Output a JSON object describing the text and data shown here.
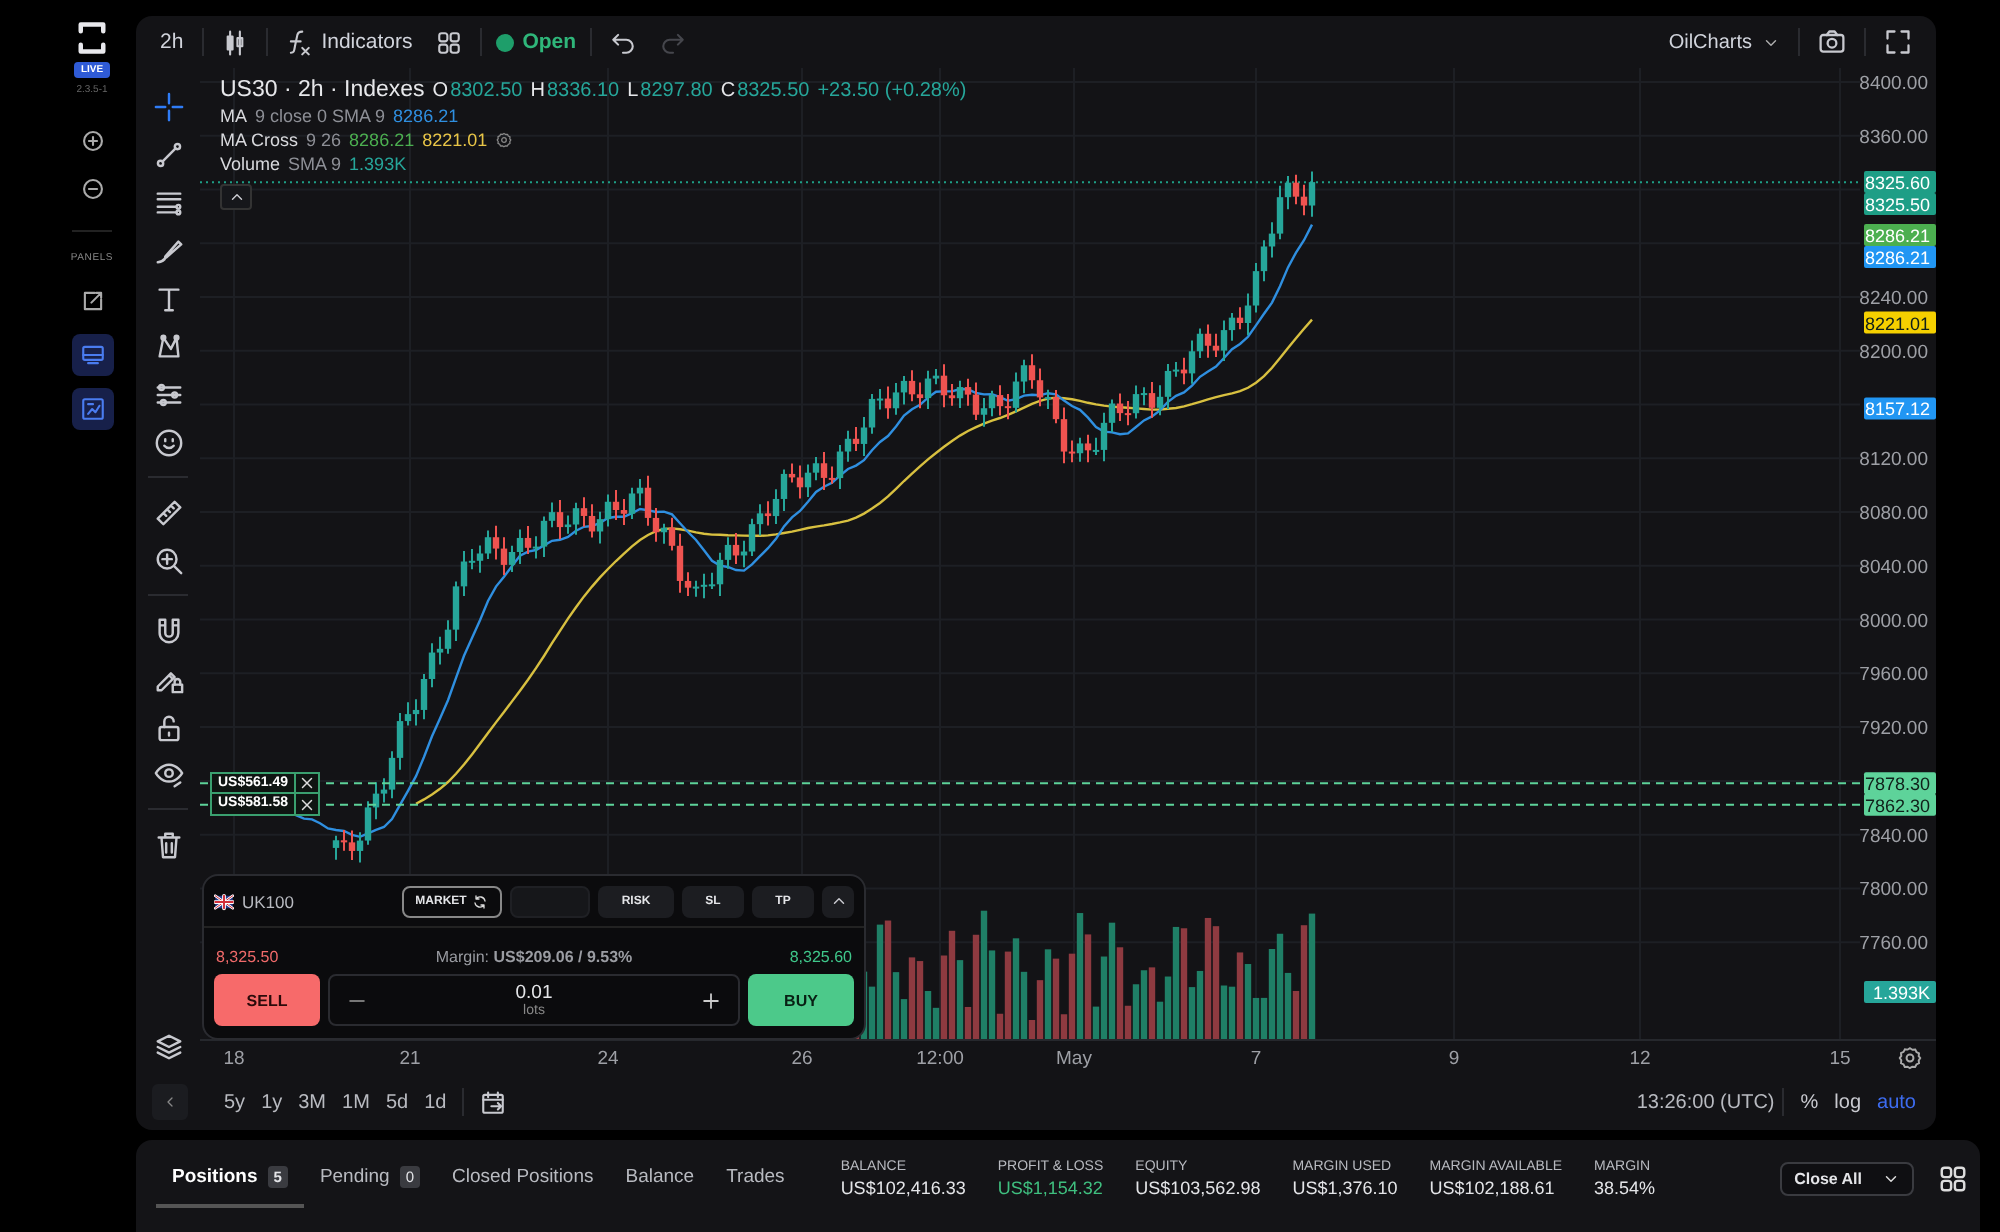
{
  "sidebar": {
    "live_badge": "LIVE",
    "version": "2.3.5-1",
    "panels_label": "PANELS",
    "panels": [
      {
        "kind": "detach",
        "selected": false
      },
      {
        "kind": "monitor",
        "selected": true
      },
      {
        "kind": "layout",
        "selected": true
      }
    ]
  },
  "toolbar": {
    "interval": "2h",
    "indicators": "Indicators",
    "market": {
      "label": "Open",
      "open": true
    },
    "undo": {
      "disabled": false
    },
    "redo": {
      "disabled": true
    },
    "account": "OilCharts"
  },
  "tool_groups": [
    [
      {
        "kind": "crosshair",
        "selected": true
      },
      {
        "kind": "line",
        "selected": false
      },
      {
        "kind": "levels",
        "selected": false
      },
      {
        "kind": "brush",
        "selected": false
      },
      {
        "kind": "text",
        "selected": false
      },
      {
        "kind": "pattern",
        "selected": false
      },
      {
        "kind": "ranges",
        "selected": false
      },
      {
        "kind": "emoji",
        "selected": false
      }
    ],
    [
      {
        "kind": "ruler",
        "selected": false
      },
      {
        "kind": "zoom",
        "selected": false
      }
    ],
    [
      {
        "kind": "magnet",
        "selected": false
      },
      {
        "kind": "draw_lock",
        "selected": false
      },
      {
        "kind": "lock",
        "selected": false
      },
      {
        "kind": "visibility",
        "selected": false
      }
    ],
    [
      {
        "kind": "trash",
        "selected": false
      }
    ]
  ],
  "legend": {
    "symbol": "US30 · 2h · Indexes",
    "ohlc": [
      {
        "label": "O",
        "value": "8302.50"
      },
      {
        "label": "H",
        "value": "8336.10"
      },
      {
        "label": "L",
        "value": "8297.80"
      },
      {
        "label": "C",
        "value": "8325.50"
      }
    ],
    "change": "+23.50 (+0.28%)",
    "indicators": [
      {
        "name": "MA",
        "params": "9 close 0 SMA 9",
        "values": [
          {
            "text": "8286.21",
            "color": "#2f8fe0"
          }
        ],
        "settings": false
      },
      {
        "name": "MA Cross",
        "params": "9 26",
        "values": [
          {
            "text": "8286.21",
            "color": "#4caf50"
          },
          {
            "text": "8221.01",
            "color": "#e8c547"
          }
        ],
        "settings": true
      },
      {
        "name": "Volume",
        "params": "SMA 9",
        "values": [
          {
            "text": "1.393K",
            "color": "#26a69a"
          }
        ],
        "settings": false
      }
    ]
  },
  "price_axis": {
    "ticks": [
      "8400.00",
      "8360.00",
      "8240.00",
      "8200.00",
      "8120.00",
      "8080.00",
      "8040.00",
      "8000.00",
      "7960.00",
      "7920.00",
      "7840.00",
      "7800.00",
      "7760.00"
    ],
    "tags": [
      {
        "kind": "price",
        "text": "8325.60",
        "color": "#1e9e86"
      },
      {
        "kind": "price",
        "text": "8325.50",
        "color": "#1e9e86"
      },
      {
        "kind": "price",
        "text": "8286.21",
        "color": "#4caf50"
      },
      {
        "kind": "price",
        "text": "8286.21",
        "color": "#2196f3"
      },
      {
        "kind": "price",
        "text": "8221.01",
        "color": "#f5d000"
      },
      {
        "kind": "price",
        "text": "8157.12",
        "color": "#2196f3"
      },
      {
        "kind": "volume",
        "text": "1.393K",
        "color": "#26a69a"
      }
    ]
  },
  "orders": [
    {
      "price": "7878.30",
      "pnl": "US$561.49"
    },
    {
      "price": "7862.30",
      "pnl": "US$581.58"
    }
  ],
  "time_axis": [
    "18",
    "21",
    "24",
    "26",
    "12:00",
    "May",
    "7",
    "9",
    "12",
    "15"
  ],
  "order_ticket": {
    "symbol": "UK100",
    "order_type": "MARKET",
    "buttons": [
      "RISK",
      "SL",
      "TP"
    ],
    "sell_price": "8,325.50",
    "margin": "Margin: **US$209.06 / 9.53%**",
    "buy_price": "8,325.60",
    "sell": "SELL",
    "buy": "BUY",
    "quantity": "0.01",
    "unit": "lots"
  },
  "footer": {
    "ranges": [
      "5y",
      "1y",
      "3M",
      "1M",
      "5d",
      "1d"
    ],
    "time": "13:26:00 (UTC)",
    "scale_options": [
      {
        "label": "%",
        "selected": false
      },
      {
        "label": "log",
        "selected": false
      },
      {
        "label": "auto",
        "selected": true
      }
    ]
  },
  "account_panel": {
    "tabs": [
      {
        "label": "Positions",
        "count": "5",
        "selected": true
      },
      {
        "label": "Pending",
        "count": "0",
        "selected": false
      },
      {
        "label": "Closed Positions",
        "selected": false
      },
      {
        "label": "Balance",
        "selected": false
      },
      {
        "label": "Trades",
        "selected": false
      }
    ],
    "stats": [
      {
        "label": "BALANCE",
        "value": "US$102,416.33"
      },
      {
        "label": "PROFIT & LOSS",
        "value": "US$1,154.32",
        "color": "#3fbf7f"
      },
      {
        "label": "EQUITY",
        "value": "US$103,562.98"
      },
      {
        "label": "MARGIN USED",
        "value": "US$1,376.10"
      },
      {
        "label": "MARGIN AVAILABLE",
        "value": "US$102,188.61"
      },
      {
        "label": "MARGIN",
        "value": "38.54%"
      }
    ],
    "close_all": "Close All"
  }
}
